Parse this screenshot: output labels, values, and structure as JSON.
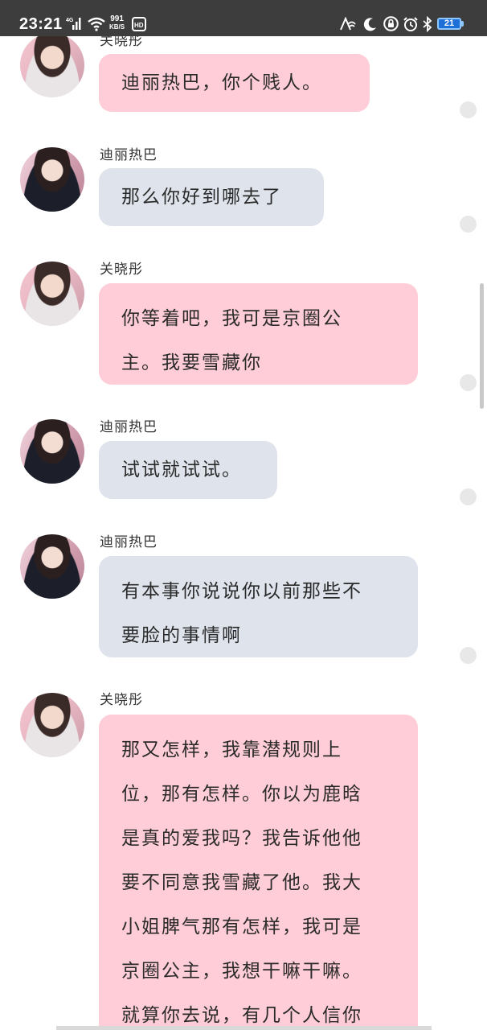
{
  "status_bar": {
    "time": "23:21",
    "network_type": "4G",
    "net_speed_value": "991",
    "net_speed_unit": "KB/S",
    "hd_label": "HD",
    "battery_level": "21"
  },
  "messages": [
    {
      "sender": "关晓彤",
      "text": "迪丽热巴，你个贱人。",
      "color": "#ffcdd7"
    },
    {
      "sender": "迪丽热巴",
      "text": "那么你好到哪去了",
      "color": "#dfe4ec"
    },
    {
      "sender": "关晓彤",
      "lines": [
        "你等着吧，我可是京圈公",
        "主。我要雪藏你"
      ],
      "color": "#ffcdd7"
    },
    {
      "sender": "迪丽热巴",
      "text": "试试就试试。",
      "color": "#dfe4ec"
    },
    {
      "sender": "迪丽热巴",
      "lines": [
        "有本事你说说你以前那些不",
        "要脸的事情啊"
      ],
      "color": "#dfe4ec"
    },
    {
      "sender": "关晓彤",
      "lines": [
        "那又怎样，我靠潜规则上",
        "位，那有怎样。你以为鹿晗",
        "是真的爱我吗？我告诉他他",
        "要不同意我雪藏了他。我大",
        "小姐脾气那有怎样，我可是",
        "京圈公主，我想干嘛干嘛。",
        "就算你去说，有几个人信你"
      ],
      "color": "#ffcdd7"
    }
  ]
}
